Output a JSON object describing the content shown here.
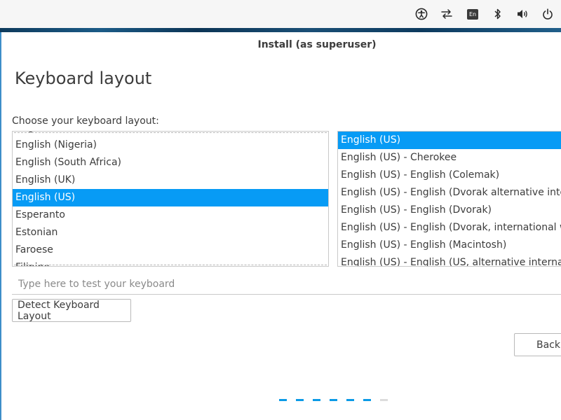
{
  "tray": {
    "icons": [
      "accessibility-icon",
      "network-icon",
      "language-icon",
      "bluetooth-icon",
      "volume-icon",
      "power-icon"
    ],
    "language_label": "En"
  },
  "window": {
    "title": "Install (as superuser)"
  },
  "page": {
    "title": "Keyboard layout",
    "prompt": "Choose your keyboard layout:"
  },
  "layouts": {
    "items": [
      "English (Ghana)",
      "English (Nigeria)",
      "English (South Africa)",
      "English (UK)",
      "English (US)",
      "Esperanto",
      "Estonian",
      "Faroese",
      "Filipino"
    ],
    "selected": "English (US)"
  },
  "variants": {
    "items": [
      "English (US)",
      "English (US) - Cherokee",
      "English (US) - English (Colemak)",
      "English (US) - English (Dvorak alternative international no dead keys)",
      "English (US) - English (Dvorak)",
      "English (US) - English (Dvorak, international with dead keys)",
      "English (US) - English (Macintosh)",
      "English (US) - English (US, alternative international)"
    ],
    "selected": "English (US)"
  },
  "test_field": {
    "placeholder": "Type here to test your keyboard",
    "value": ""
  },
  "buttons": {
    "detect": "Detect Keyboard Layout",
    "back": "Back"
  },
  "progress": {
    "total_steps": 7,
    "completed_steps": 6
  },
  "colors": {
    "accent": "#079bf5",
    "progress_active": "#0a9ae6",
    "progress_inactive": "#dcdcdc",
    "window_border": "#3d8ec9"
  }
}
